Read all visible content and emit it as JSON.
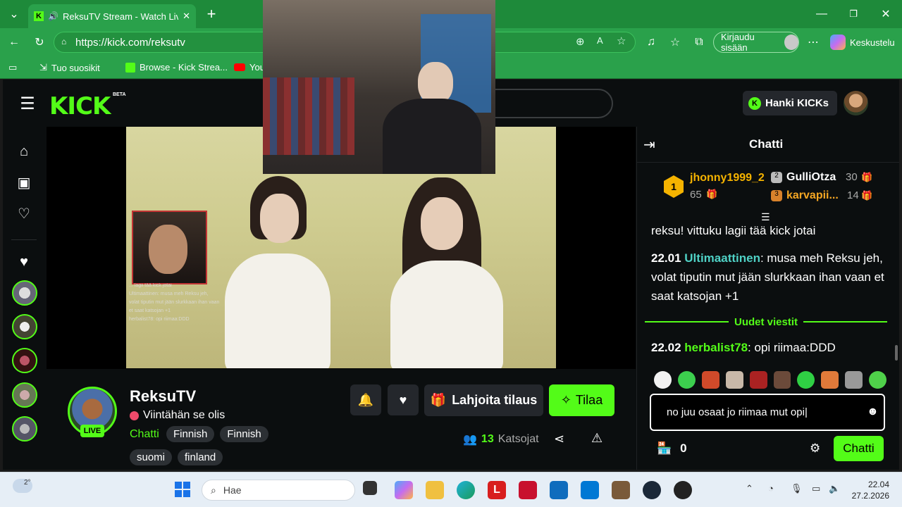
{
  "browser": {
    "tab_title": "ReksuTV Stream - Watch Live",
    "url": "https://kick.com/reksutv",
    "signin_label": "Kirjaudu sisään",
    "copilot_label": "Keskustelu",
    "bookmarks": [
      "Tuo suosikit",
      "Browse - Kick Strea...",
      "You"
    ]
  },
  "kick": {
    "logo": "KICK",
    "beta": "BETA",
    "get_kicks": "Hanki KICKs"
  },
  "overlay_chat": [
    "... lagii tää kick jotai",
    "Ultimaattinen: musa meh Reksu jeh,",
    "volat tiputin mut jään slurkkaan ihan vaan",
    "et saat katsojan +1",
    "herbalist78: opi riimaa:DDD"
  ],
  "stream": {
    "streamer": "ReksuTV",
    "title": "Viintähän se olis",
    "live_badge": "LIVE",
    "category": "Chatti",
    "tags_row1": [
      "Finnish",
      "Finnish"
    ],
    "tags_row2": [
      "suomi",
      "finland"
    ],
    "gift_label": "Lahjoita tilaus",
    "subscribe_label": "Tilaa",
    "viewers_count": "13",
    "viewers_label": "Katsojat"
  },
  "chat": {
    "title": "Chatti",
    "gifters": [
      {
        "rank": "1",
        "name": "jhonny1999_2",
        "count": "65"
      },
      {
        "rank": "2",
        "name": "GulliOtza",
        "count": "30"
      },
      {
        "rank": "3",
        "name": "karvapii...",
        "count": "14"
      }
    ],
    "messages": [
      {
        "time": "",
        "user": "",
        "text": "reksu! vittuku lagii tää kick jotai",
        "color": "#ffffff"
      },
      {
        "time": "22.01",
        "user": "Ultimaattinen",
        "text": ": musa meh Reksu jeh, volat tiputin mut jään slurkkaan ihan vaan et saat katsojan +1",
        "color": "#4fd1c5"
      },
      {
        "time": "22.02",
        "user": "herbalist78",
        "text": ": opi riimaa:DDD",
        "color": "#53fc18"
      }
    ],
    "new_messages_label": "Uudet viestit",
    "input_value": "no juu osaat jo riimaa mut opi",
    "points": "0",
    "send_label": "Chatti"
  },
  "taskbar": {
    "weather": "2°",
    "search_placeholder": "Hae",
    "time": "22.04",
    "date": "27.2.2026"
  },
  "colors": {
    "kick_green": "#53fc18",
    "browser_green": "#2aa14b"
  }
}
